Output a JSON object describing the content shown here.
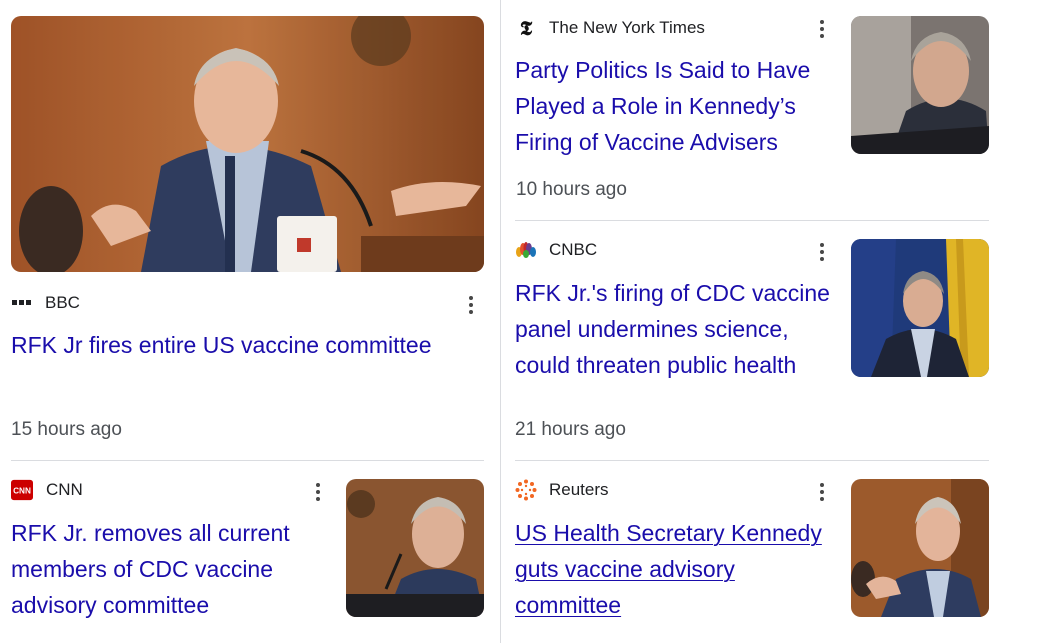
{
  "articles": [
    {
      "source": "BBC",
      "source_icon": "bbc-logo-icon",
      "headline": "RFK Jr fires entire US vaccine committee",
      "time": "15 hours ago",
      "image": "speaker-at-hearing-photo"
    },
    {
      "source": "The New York Times",
      "source_icon": "nyt-logo-icon",
      "headline": "Party Politics Is Said to Have Played a Role in Kennedy’s Firing of Vaccine Advisers",
      "time": "10 hours ago",
      "image": "man-portrait-photo"
    },
    {
      "source": "CNBC",
      "source_icon": "cnbc-peacock-icon",
      "headline": "RFK Jr.'s firing of CDC vaccine panel undermines science, could threaten public health",
      "time": "21 hours ago",
      "image": "man-in-front-of-flags-photo"
    },
    {
      "source": "CNN",
      "source_icon": "cnn-logo-icon",
      "headline": "RFK Jr. removes all current members of CDC vaccine advisory committee",
      "image": "speaker-at-microphone-photo"
    },
    {
      "source": "Reuters",
      "source_icon": "reuters-logo-icon",
      "headline": "US Health Secretary Kennedy guts vaccine advisory committee",
      "image": "speaker-gesturing-photo"
    }
  ],
  "menu_icon": "more-vert-icon",
  "colors": {
    "link": "#1a0dab",
    "meta": "#4d5156",
    "divider": "#dadce0",
    "cnn_red": "#cc0000"
  }
}
